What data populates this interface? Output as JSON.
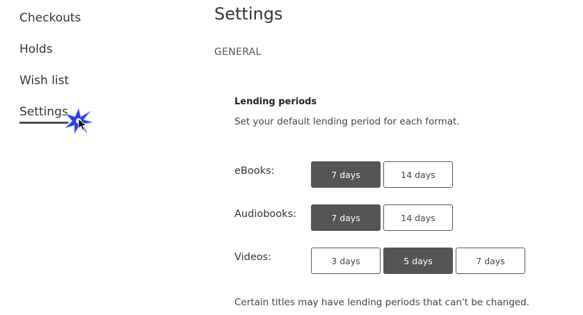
{
  "sidebar": {
    "items": [
      {
        "label": "Checkouts"
      },
      {
        "label": "Holds"
      },
      {
        "label": "Wish list"
      },
      {
        "label": "Settings"
      }
    ]
  },
  "main": {
    "title": "Settings",
    "section": "GENERAL",
    "lending": {
      "title": "Lending periods",
      "description": "Set your default lending period for each format.",
      "rows": [
        {
          "label": "eBooks:",
          "options": [
            "7 days",
            "14 days"
          ],
          "selected": "7 days"
        },
        {
          "label": "Audiobooks:",
          "options": [
            "7 days",
            "14 days"
          ],
          "selected": "7 days"
        },
        {
          "label": "Videos:",
          "options": [
            "3 days",
            "5 days",
            "7 days"
          ],
          "selected": "5 days"
        }
      ],
      "note": "Certain titles may have lending periods that can't be changed."
    }
  },
  "colors": {
    "selected_bg": "#555555",
    "text": "#333333",
    "click_burst": "#2b3de0"
  },
  "icons": {
    "click": "click-burst-icon",
    "cursor": "mouse-cursor-icon"
  }
}
